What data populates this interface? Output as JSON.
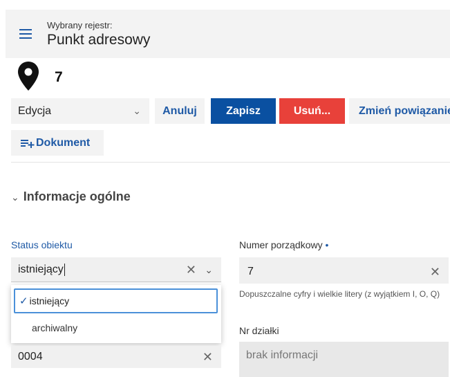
{
  "header": {
    "registry_label": "Wybrany rejestr:",
    "registry_title": "Punkt adresowy"
  },
  "object": {
    "number": "7"
  },
  "toolbar": {
    "mode_value": "Edycja",
    "cancel_label": "Anuluj",
    "save_label": "Zapisz",
    "delete_label": "Usuń...",
    "change_relation_label": "Zmień powiązanie",
    "document_label": "Dokument"
  },
  "section": {
    "title": "Informacje ogólne"
  },
  "fields": {
    "status": {
      "label": "Status obiektu",
      "value": "istniejący",
      "options": [
        "istniejący",
        "archiwalny"
      ],
      "selected_index": 0
    },
    "numer": {
      "label": "Numer porządkowy",
      "required_marker": "•",
      "value": "7",
      "hint": "Dopuszczalne cyfry i wielkie litery (z wyjątkiem I, O, Q)"
    },
    "dzialka_code": {
      "value": "0004"
    },
    "nr_dzialki": {
      "label": "Nr działki",
      "value": "brak informacji"
    }
  },
  "icons": {
    "menu": "hamburger-icon",
    "pin": "map-pin-icon",
    "dropdown": "chevron-down-icon",
    "clear": "close-icon",
    "check": "check-icon",
    "document_add": "add-document-icon"
  },
  "colors": {
    "accent": "#1f5aa6",
    "primary_button": "#0a50a1",
    "danger_button": "#e8413a"
  }
}
